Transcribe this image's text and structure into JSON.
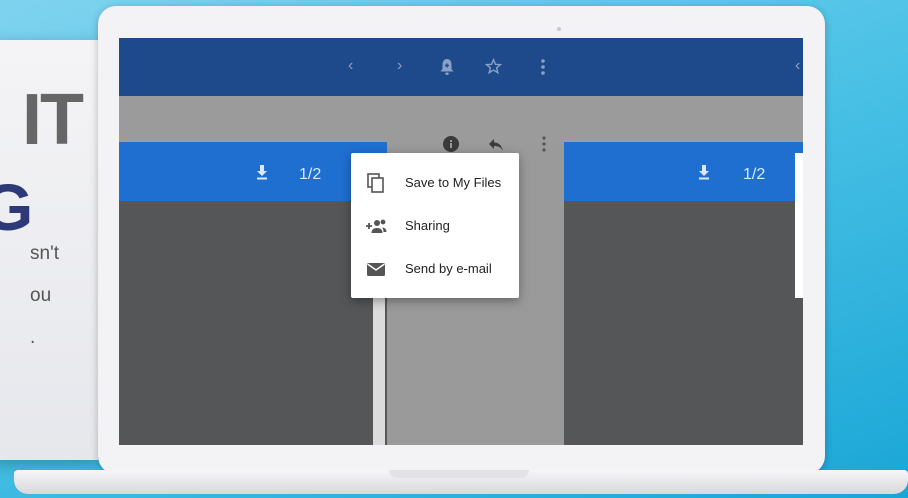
{
  "background_card": {
    "line1": "IT",
    "line2": "G",
    "line3": "sn't",
    "line4": "ou",
    "line5": "."
  },
  "toolbar": {
    "back_icon": "chevron-left",
    "forward_icon": "chevron-right",
    "bell_icon": "bell-plus",
    "star_icon": "star-outline",
    "more_icon": "more-vertical",
    "extra_back_icon": "chevron-left"
  },
  "viewer_left": {
    "page_indicator": "1/2",
    "download_icon": "download"
  },
  "viewer_right": {
    "page_indicator": "1/2",
    "download_icon": "download"
  },
  "message_actions": {
    "info_icon": "info",
    "reply_icon": "reply",
    "more_icon": "more-vertical"
  },
  "context_menu": {
    "items": [
      {
        "label": "Save to My Files",
        "icon": "copy"
      },
      {
        "label": "Sharing",
        "icon": "person-add"
      },
      {
        "label": "Send by e-mail",
        "icon": "envelope"
      }
    ]
  },
  "colors": {
    "topbar": "#1e4a8c",
    "panel_header": "#1e6fd0",
    "panel_body": "#545658",
    "gutter": "#9a9a9a"
  }
}
